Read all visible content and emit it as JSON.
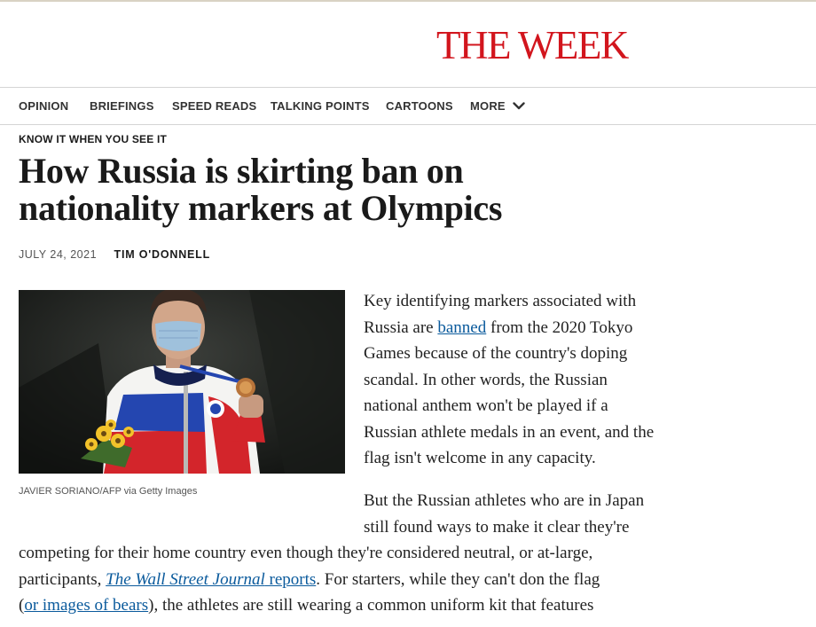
{
  "masthead": {
    "logo": "THE WEEK"
  },
  "nav": {
    "items": [
      "OPINION",
      "BRIEFINGS",
      "SPEED READS",
      "TALKING POINTS",
      "CARTOONS",
      "MORE"
    ]
  },
  "article": {
    "kicker": "KNOW IT WHEN YOU SEE IT",
    "headline": {
      "line1": "How Russia is skirting ban on",
      "line2": "nationality markers at Olympics"
    },
    "date": "JULY 24, 2021",
    "author": "TIM O'DONNELL",
    "image_caption": "JAVIER SORIANO/AFP via Getty Images",
    "p1": {
      "l1": "Key identifying markers associated with",
      "l2_pre": "Russia are ",
      "l2_link": "banned",
      "l2_post": " from the 2020 Tokyo",
      "l3": "Games because of the country's doping",
      "l4": "scandal. In other words, the Russian",
      "l5": "national anthem won't be played if a",
      "l6": "Russian athlete medals in an event, and the",
      "l7": "flag isn't welcome in any capacity."
    },
    "p2": {
      "l1": "But the Russian athletes who are in Japan",
      "l2": "still found ways to make it clear they're",
      "l3": "competing for their home country even though they're considered neutral, or at-large,",
      "l4_pre": "participants, ",
      "l4_link_italic": "The Wall Street Journal",
      "l4_link_rest": " reports",
      "l4_post": ". For starters, while they can't don the flag",
      "l5_open": "(",
      "l5_link": "or images of bears",
      "l5_post": "), the athletes are still wearing a common uniform kit that features"
    }
  },
  "colors": {
    "brand_red": "#d2151d",
    "link_blue": "#0a5a9c",
    "text": "#1a1a1a"
  }
}
